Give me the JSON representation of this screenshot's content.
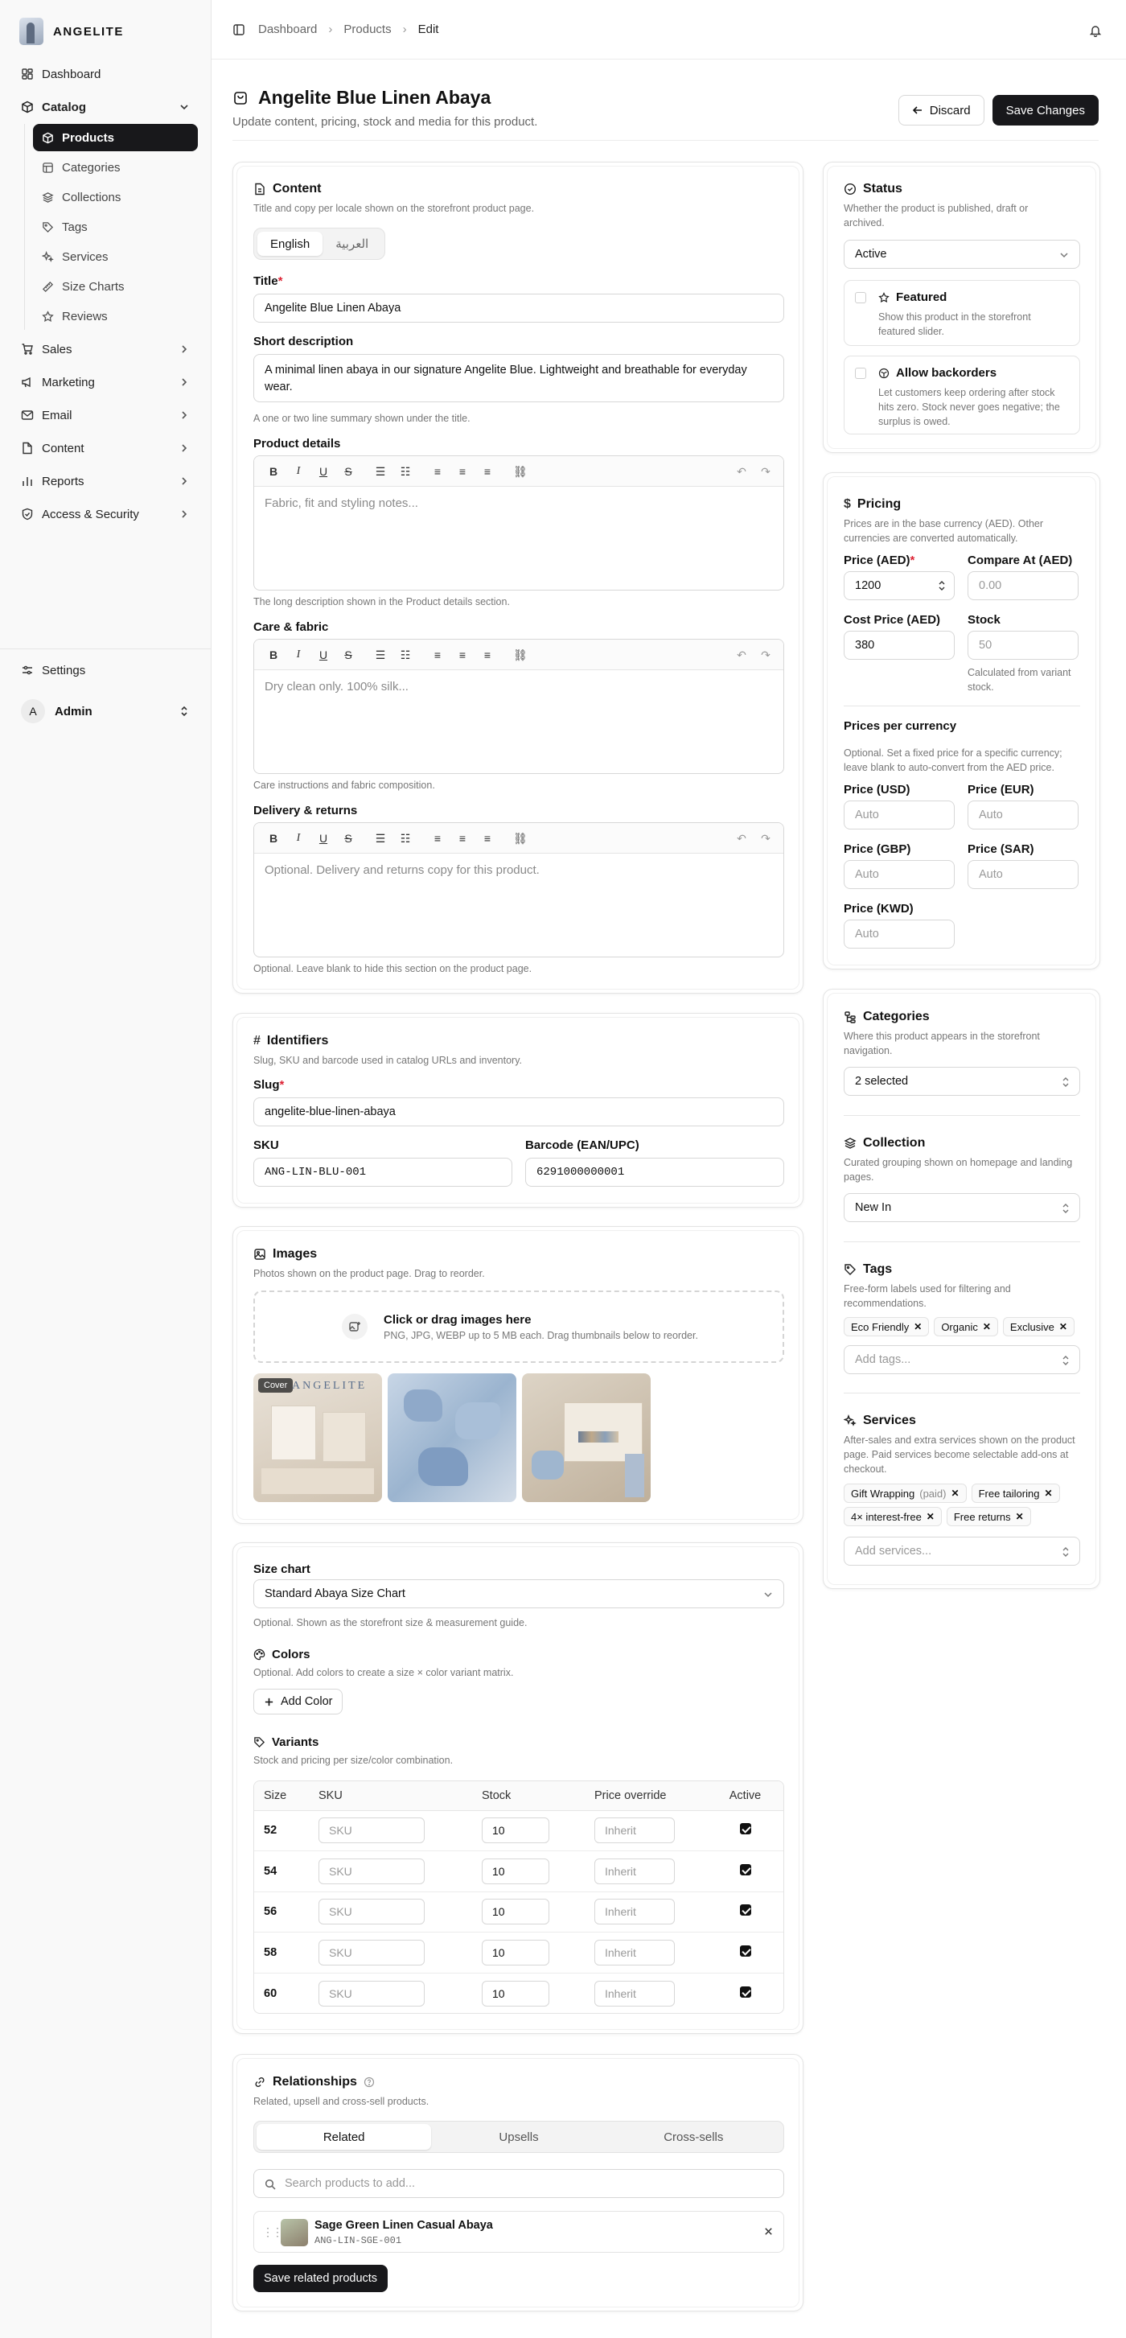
{
  "brand": {
    "name": "ANGELITE"
  },
  "sidebar": {
    "items": {
      "dashboard": "Dashboard",
      "catalog": "Catalog",
      "sales": "Sales",
      "marketing": "Marketing",
      "email": "Email",
      "content": "Content",
      "reports": "Reports",
      "access": "Access & Security",
      "settings": "Settings"
    },
    "catalog_sub": [
      "Products",
      "Categories",
      "Collections",
      "Tags",
      "Services",
      "Size Charts",
      "Reviews"
    ],
    "user": {
      "initial": "A",
      "name": "Admin"
    }
  },
  "breadcrumb": [
    "Dashboard",
    "Products",
    "Edit"
  ],
  "header": {
    "title": "Angelite Blue Linen Abaya",
    "subtitle": "Update content, pricing, stock and media for this product.",
    "discard": "Discard",
    "save": "Save Changes"
  },
  "content_card": {
    "title": "Content",
    "desc": "Title and copy per locale shown on the storefront product page.",
    "locales": [
      "English",
      "العربية"
    ],
    "title_label": "Title",
    "title_value": "Angelite Blue Linen Abaya",
    "short_label": "Short description",
    "short_value": "A minimal linen abaya in our signature Angelite Blue. Lightweight and breathable for everyday wear.",
    "short_help": "A one or two line summary shown under the title.",
    "details_label": "Product details",
    "details_ph": "Fabric, fit and styling notes...",
    "details_help": "The long description shown in the Product details section.",
    "care_label": "Care & fabric",
    "care_ph": "Dry clean only. 100% silk...",
    "care_help": "Care instructions and fabric composition.",
    "delivery_label": "Delivery & returns",
    "delivery_ph": "Optional. Delivery and returns copy for this product.",
    "delivery_help": "Optional. Leave blank to hide this section on the product page."
  },
  "identifiers": {
    "title": "Identifiers",
    "desc": "Slug, SKU and barcode used in catalog URLs and inventory.",
    "slug_label": "Slug",
    "slug": "angelite-blue-linen-abaya",
    "sku_label": "SKU",
    "sku": "ANG-LIN-BLU-001",
    "barcode_label": "Barcode (EAN/UPC)",
    "barcode": "6291000000001"
  },
  "images": {
    "title": "Images",
    "desc": "Photos shown on the product page. Drag to reorder.",
    "drop_title": "Click or drag images here",
    "drop_desc": "PNG, JPG, WEBP up to 5 MB each. Drag thumbnails below to reorder.",
    "cover": "Cover",
    "cover_word": "ANGELITE"
  },
  "variants_card": {
    "size_chart_label": "Size chart",
    "size_chart": "Standard Abaya Size Chart",
    "size_chart_help": "Optional. Shown as the storefront size & measurement guide.",
    "colors_title": "Colors",
    "colors_desc": "Optional. Add colors to create a size × color variant matrix.",
    "add_color": "Add Color",
    "variants_title": "Variants",
    "variants_desc": "Stock and pricing per size/color combination.",
    "columns": [
      "Size",
      "SKU",
      "Stock",
      "Price override",
      "Active"
    ],
    "sku_ph": "SKU",
    "price_ph": "Inherit",
    "rows": [
      {
        "size": "52",
        "stock": "10"
      },
      {
        "size": "54",
        "stock": "10"
      },
      {
        "size": "56",
        "stock": "10"
      },
      {
        "size": "58",
        "stock": "10"
      },
      {
        "size": "60",
        "stock": "10"
      }
    ]
  },
  "relationships": {
    "title": "Relationships",
    "desc": "Related, upsell and cross-sell products.",
    "tabs": [
      "Related",
      "Upsells",
      "Cross-sells"
    ],
    "search_ph": "Search products to add...",
    "item_name": "Sage Green Linen Casual Abaya",
    "item_sku": "ANG-LIN-SGE-001",
    "save": "Save related products"
  },
  "status": {
    "title": "Status",
    "desc": "Whether the product is published, draft or archived.",
    "value": "Active",
    "featured_title": "Featured",
    "featured_desc": "Show this product in the storefront featured slider.",
    "backorder_title": "Allow backorders",
    "backorder_desc": "Let customers keep ordering after stock hits zero. Stock never goes negative; the surplus is owed."
  },
  "pricing": {
    "title": "Pricing",
    "desc": "Prices are in the base currency (AED). Other currencies are converted automatically.",
    "price_label": "Price (AED)",
    "price": "1200",
    "compare_label": "Compare At (AED)",
    "compare_ph": "0.00",
    "cost_label": "Cost Price (AED)",
    "cost": "380",
    "stock_label": "Stock",
    "stock_ph": "50",
    "stock_help": "Calculated from variant stock.",
    "ppc_title": "Prices per currency",
    "ppc_desc": "Optional. Set a fixed price for a specific currency; leave blank to auto-convert from the AED price.",
    "usd": "Price (USD)",
    "eur": "Price (EUR)",
    "gbp": "Price (GBP)",
    "sar": "Price (SAR)",
    "kwd": "Price (KWD)",
    "auto": "Auto"
  },
  "taxonomy": {
    "cat_title": "Categories",
    "cat_desc": "Where this product appears in the storefront navigation.",
    "cat_value": "2 selected",
    "col_title": "Collection",
    "col_desc": "Curated grouping shown on homepage and landing pages.",
    "col_value": "New In",
    "tags_title": "Tags",
    "tags_desc": "Free-form labels used for filtering and recommendations.",
    "tags": [
      "Eco Friendly",
      "Organic",
      "Exclusive"
    ],
    "tags_ph": "Add tags...",
    "svc_title": "Services",
    "svc_desc": "After-sales and extra services shown on the product page. Paid services become selectable add-ons at checkout.",
    "services": [
      {
        "name": "Gift Wrapping",
        "paid": "(paid)"
      },
      {
        "name": "Free tailoring",
        "paid": ""
      },
      {
        "name": "4× interest-free",
        "paid": ""
      },
      {
        "name": "Free returns",
        "paid": ""
      }
    ],
    "svc_ph": "Add services..."
  }
}
